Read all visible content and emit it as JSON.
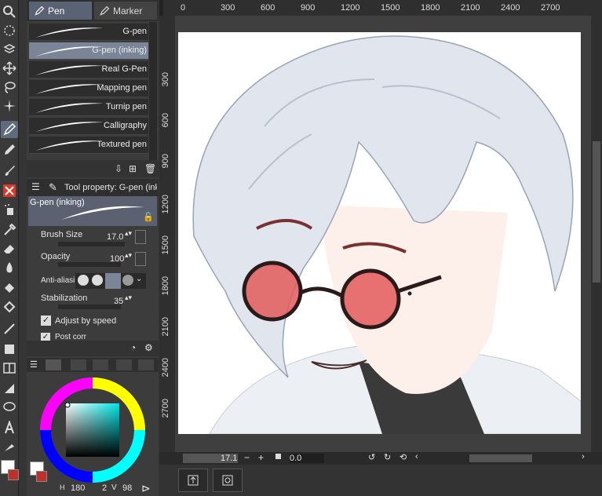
{
  "tabs": {
    "pen": "Pen",
    "marker": "Marker"
  },
  "brushes": [
    {
      "label": "G-pen",
      "selected": false
    },
    {
      "label": "G-pen (inking)",
      "selected": true
    },
    {
      "label": "Real G-Pen",
      "selected": false
    },
    {
      "label": "Mapping pen",
      "selected": false
    },
    {
      "label": "Turnip pen",
      "selected": false
    },
    {
      "label": "Calligraphy",
      "selected": false
    },
    {
      "label": "Textured pen",
      "selected": false
    }
  ],
  "tool_property": {
    "title": "Tool property: G-pen (inkin",
    "preview_label": "G-pen (inking)",
    "brush_size_label": "Brush Size",
    "brush_size_value": "17.0",
    "opacity_label": "Opacity",
    "opacity_value": "100",
    "anti_aliasing_label": "Anti-aliasin",
    "stabilization_label": "Stabilization",
    "stabilization_value": "35",
    "adjust_by_speed_label": "Adjust by speed",
    "post_correction_label": "Post corr"
  },
  "ruler_top": [
    "0",
    "300",
    "600",
    "900",
    "1200",
    "1500",
    "1800",
    "2100",
    "2400",
    "2700"
  ],
  "ruler_left": [
    "300",
    "600",
    "900",
    "1200",
    "1500",
    "1800",
    "2100",
    "2400",
    "2700"
  ],
  "status": {
    "zoom": "17.1",
    "rotation": "0.0"
  },
  "color_panel": {
    "main_color": "#ffffff",
    "sub_color": "#c0302a",
    "hue_value": "180",
    "sat_value": "2",
    "val_value": "98",
    "v_label": "V"
  }
}
